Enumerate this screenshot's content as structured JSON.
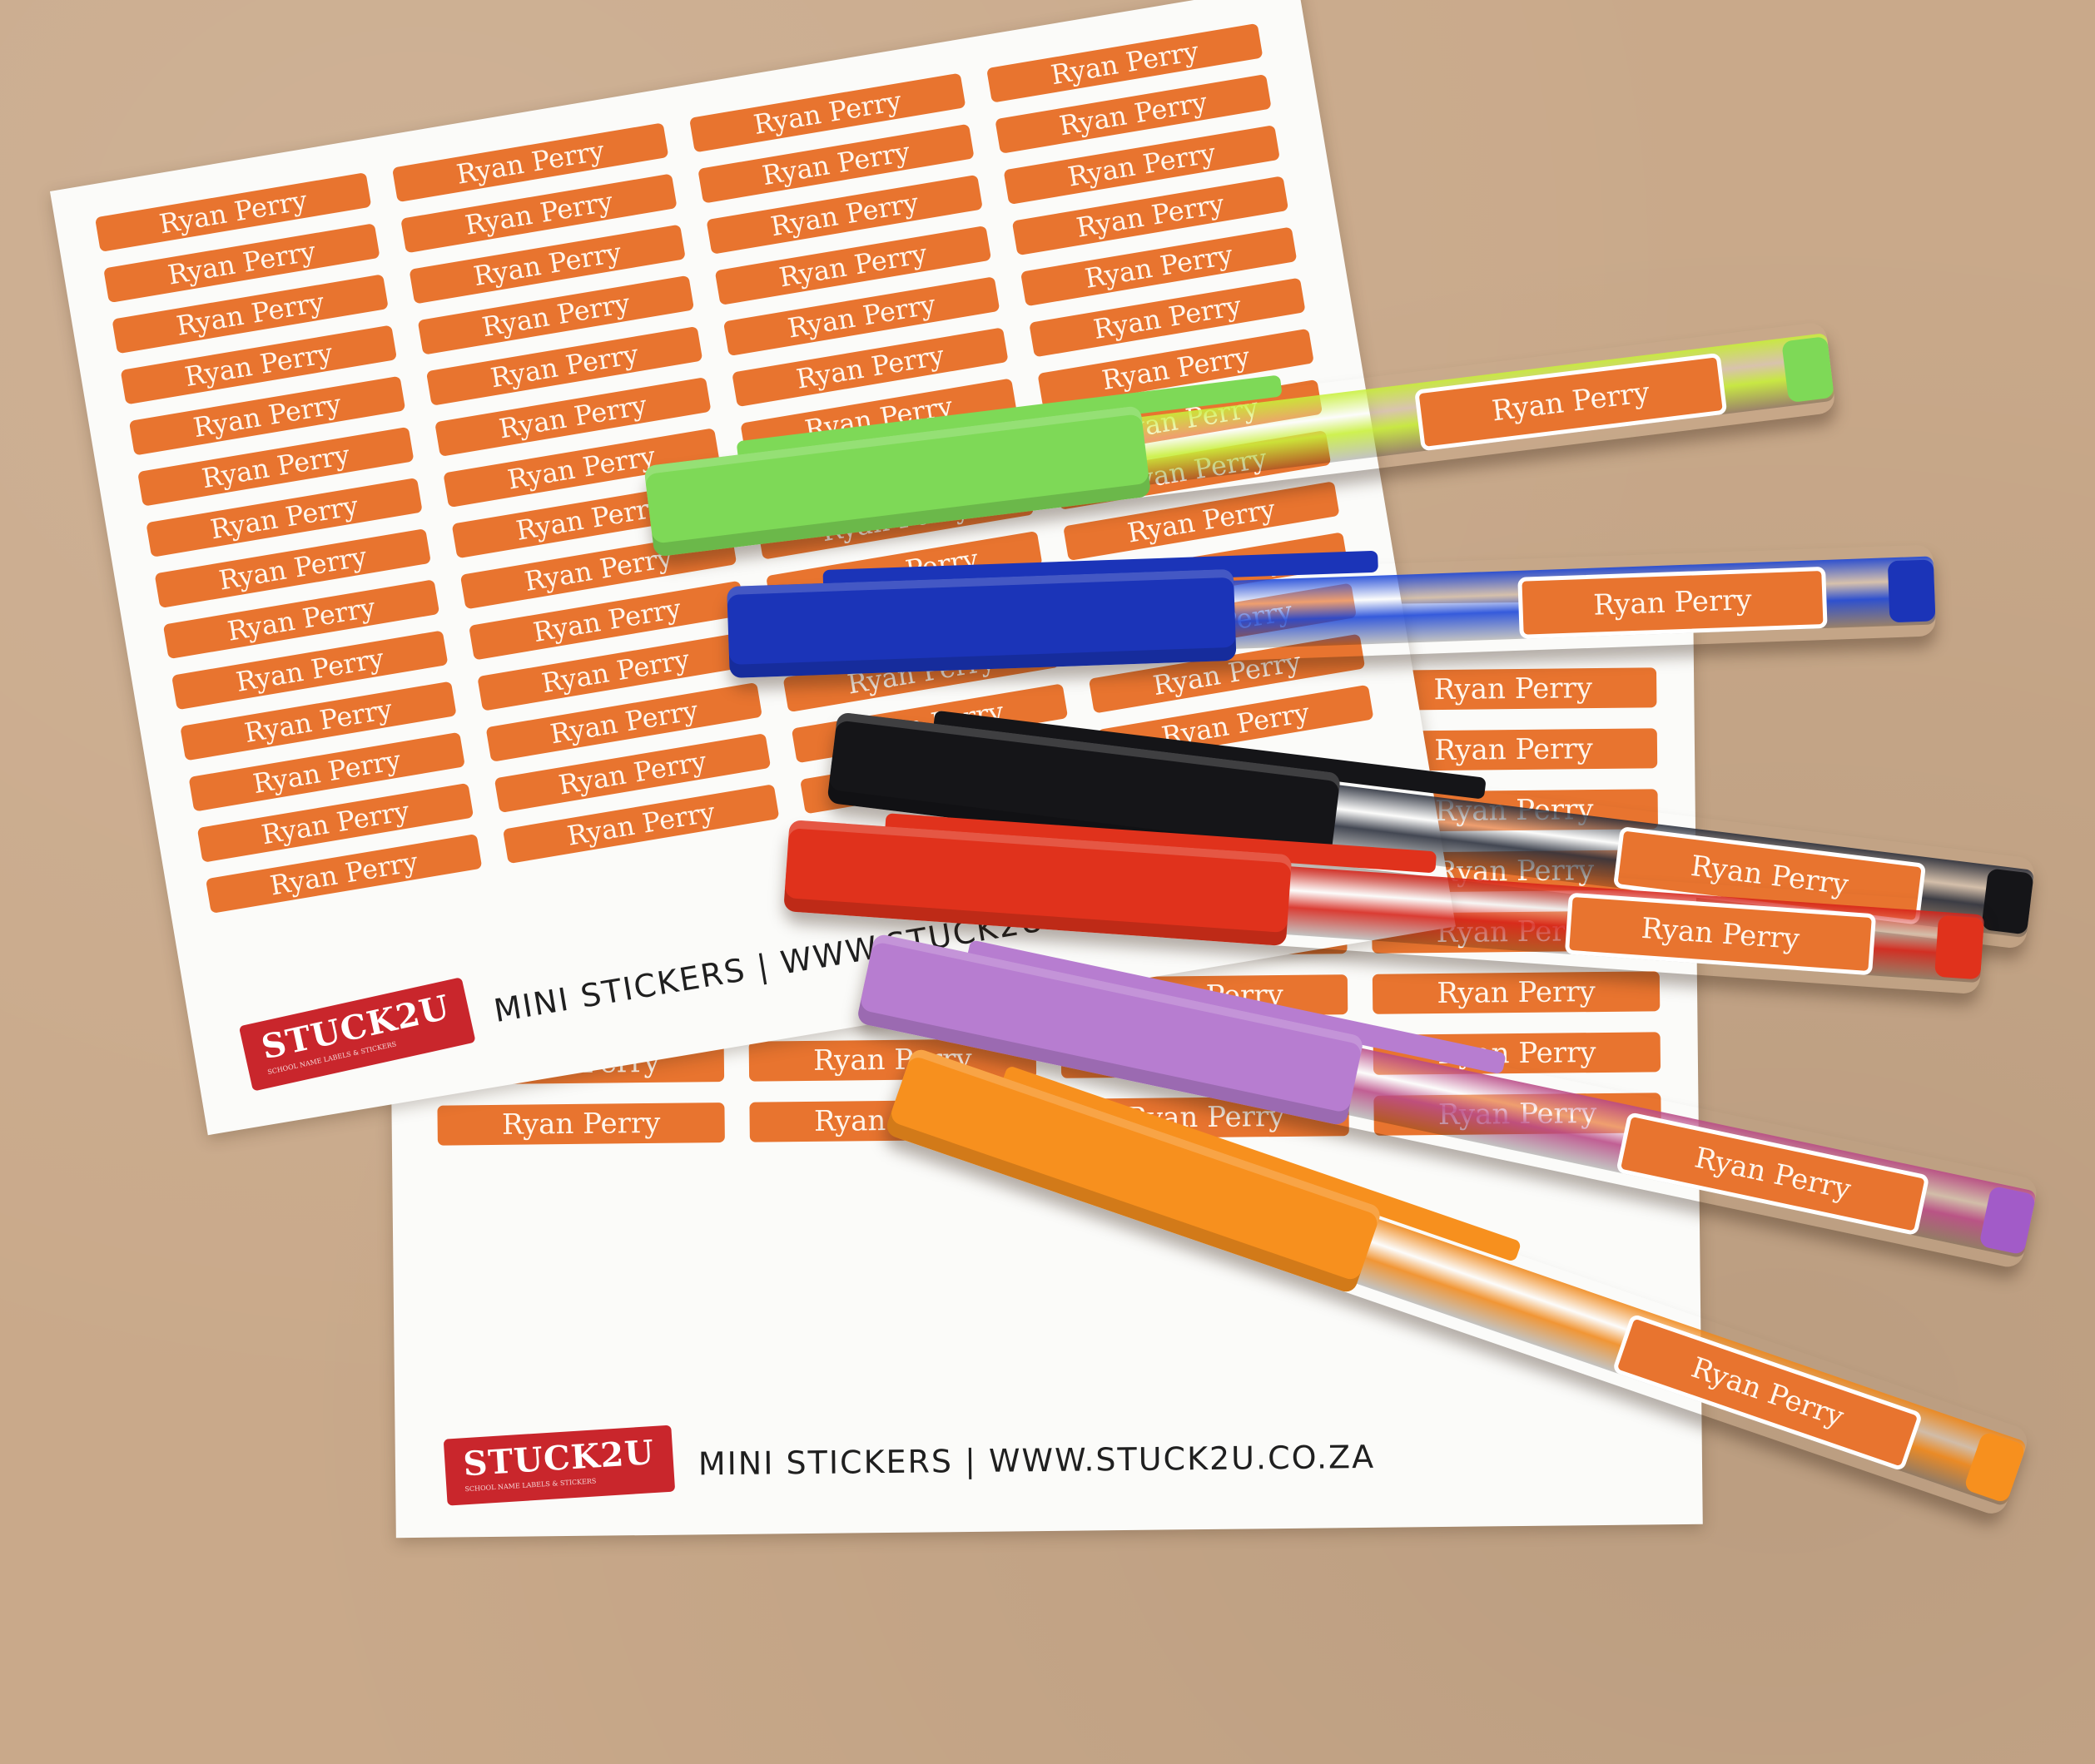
{
  "sticker_name": "Ryan Perry",
  "sheet_front": {
    "brand": "STUCK2U",
    "brand_tagline": "SCHOOL NAME LABELS & STICKERS",
    "footer_text": "MINI STICKERS | WWW.STUCK2U.CO.ZA",
    "label_count": 56
  },
  "sheet_back": {
    "brand": "STUCK2U",
    "brand_tagline": "SCHOOL NAME LABELS & STICKERS",
    "footer_text": "MINI STICKERS | WWW.STUCK2U.CO.ZA",
    "label_count": 32
  },
  "pens": [
    {
      "name": "green-pen",
      "cap": "#7ed957",
      "barrel": "#c8f03a",
      "end": "#7ed957",
      "label": "Ryan Perry"
    },
    {
      "name": "blue-pen",
      "cap": "#1b34b8",
      "barrel": "#1a45d8",
      "end": "#1b34b8",
      "label": "Ryan Perry"
    },
    {
      "name": "black-pen",
      "cap": "#151518",
      "barrel": "#2a2f3c",
      "end": "#151518",
      "label": "Ryan Perry"
    },
    {
      "name": "red-pen",
      "cap": "#e0321c",
      "barrel": "#d62218",
      "end": "#e0321c",
      "label": "Ryan Perry"
    },
    {
      "name": "purple-pen",
      "cap": "#b77dd0",
      "barrel": "#b94a86",
      "end": "#a25bc8",
      "label": "Ryan Perry"
    },
    {
      "name": "orange-pen",
      "cap": "#f7901e",
      "barrel": "#f0881a",
      "end": "#f7901e",
      "label": "Ryan Perry"
    }
  ],
  "colors": {
    "background": "#c9a98a",
    "sticker": "#e8742f",
    "logo": "#c9262c"
  }
}
